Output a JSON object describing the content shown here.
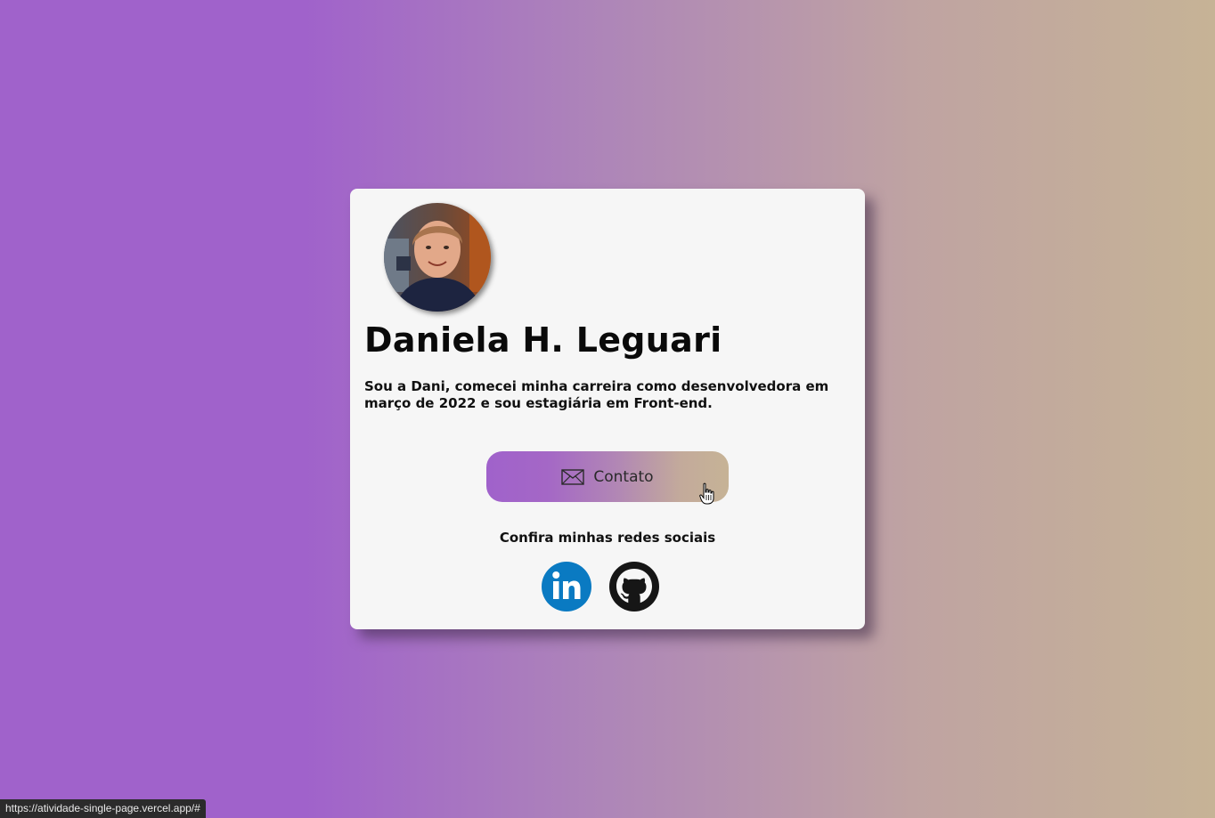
{
  "profile": {
    "name": "Daniela H. Leguari",
    "bio": "Sou a Dani, comecei minha carreira como desenvolvedora em março de 2022 e sou estagiária em Front-end.",
    "avatar_alt": "Foto de perfil"
  },
  "contact": {
    "label": "Contato",
    "icon": "envelope-icon"
  },
  "social": {
    "title": "Confira minhas redes sociais",
    "links": [
      {
        "name": "LinkedIn",
        "icon": "linkedin-icon",
        "color": "#0a7ac2"
      },
      {
        "name": "GitHub",
        "icon": "github-icon",
        "color": "#161616"
      }
    ]
  },
  "status_bar": {
    "url": "https://atividade-single-page.vercel.app/#"
  },
  "theme": {
    "gradient_start": "#a062cb",
    "gradient_end": "#c6b396",
    "card_background": "#f6f6f6"
  }
}
